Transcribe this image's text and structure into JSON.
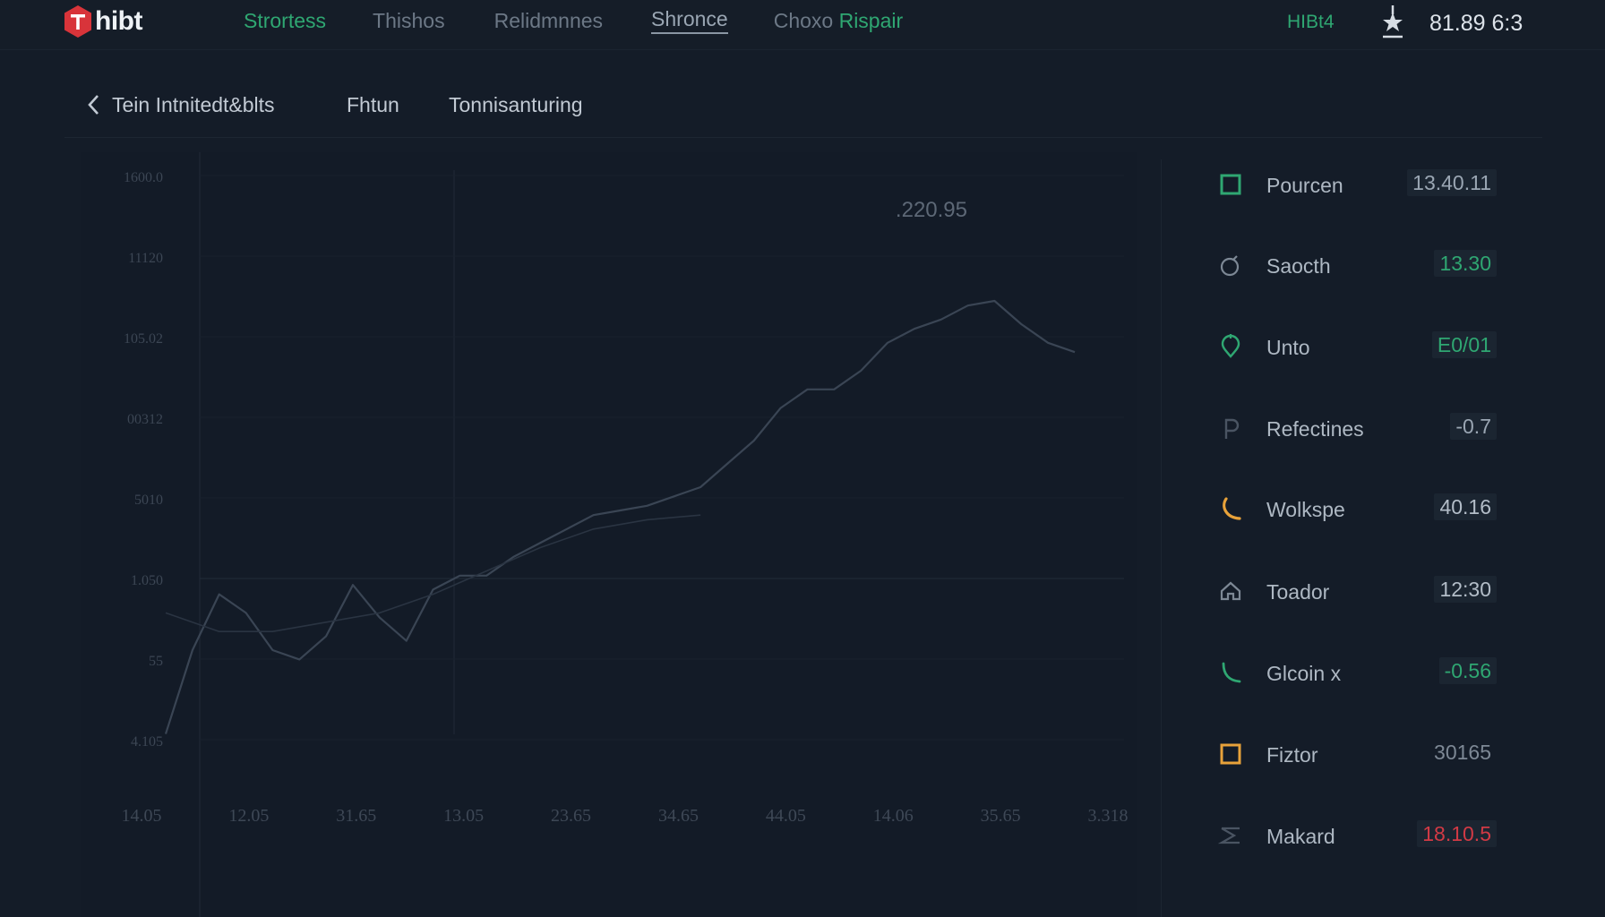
{
  "app": {
    "logo_text": "hibt"
  },
  "nav": {
    "items": [
      {
        "label": "Strortess"
      },
      {
        "label": "Thishos"
      },
      {
        "label": "Relidmnnes"
      },
      {
        "label": "Shronce"
      },
      {
        "label": "Choxo",
        "accent": "Rispair"
      }
    ]
  },
  "header": {
    "pair_label": "HIBt4",
    "clock": "81.89 6:3"
  },
  "subnav": {
    "back_label": "Tein Intnitedt&blts",
    "tabs": [
      "Fhtun",
      "Tonnisanturing"
    ]
  },
  "chart_data": {
    "type": "line",
    "title": "",
    "price_label": ".220.95",
    "y_ticks": [
      "1600.0",
      "11120",
      "105.02",
      "00312",
      "5010",
      "1.050",
      "55",
      "4.105"
    ],
    "x_ticks": [
      "14.05",
      "12.05",
      "31.65",
      "13.05",
      "23.65",
      "34.65",
      "44.05",
      "14.06",
      "35.65",
      "3.318"
    ],
    "ylim": [
      0,
      100
    ],
    "grid": true,
    "series": [
      {
        "color": "#3a4554",
        "x": [
          0,
          1,
          2,
          3,
          4,
          5,
          6,
          7,
          8,
          9,
          10,
          11,
          12,
          13,
          14,
          15,
          16,
          17,
          18,
          19,
          20,
          21,
          22,
          23,
          24,
          25,
          26,
          27,
          28,
          29,
          30,
          31,
          32,
          33,
          34
        ],
        "values": [
          2,
          20,
          32,
          28,
          20,
          18,
          23,
          34,
          27,
          22,
          33,
          36,
          36,
          40,
          43,
          46,
          49,
          50,
          51,
          53,
          55,
          60,
          65,
          72,
          76,
          76,
          80,
          86,
          89,
          91,
          94,
          95,
          90,
          86,
          84
        ]
      },
      {
        "color": "#2a3442",
        "x": [
          0,
          2,
          4,
          6,
          8,
          10,
          12,
          14,
          16,
          18,
          20
        ],
        "values": [
          28,
          24,
          24,
          26,
          28,
          32,
          37,
          42,
          46,
          48,
          49
        ]
      }
    ]
  },
  "side_items": [
    {
      "label": "Pourcen",
      "value": "13.40.11",
      "icon": "square-outline-icon",
      "icon_color": "#2fa772",
      "value_color": "#9aa6b3",
      "boxed": true
    },
    {
      "label": "Saocth",
      "value": "13.30",
      "icon": "bomb-icon",
      "icon_color": "#7d8895",
      "value_color": "#2fa772",
      "boxed": true
    },
    {
      "label": "Unto",
      "value": "E0/01",
      "icon": "pin-icon",
      "icon_color": "#2fa772",
      "value_color": "#2fa772",
      "boxed": true
    },
    {
      "label": "Refectines",
      "value": "-0.7",
      "icon": "p-icon",
      "icon_color": "#4a5462",
      "value_color": "#9aa6b3",
      "boxed": true
    },
    {
      "label": "Wolkspe",
      "value": "40.16",
      "icon": "moon-icon",
      "icon_color": "#e8a23a",
      "value_color": "#b3bdc8",
      "boxed": true
    },
    {
      "label": "Toador",
      "value": "12:30",
      "icon": "house-icon",
      "icon_color": "#7d8895",
      "value_color": "#b3bdc8",
      "boxed": true
    },
    {
      "label": "Glcoin x",
      "value": "-0.56",
      "icon": "curve-icon",
      "icon_color": "#2fa772",
      "value_color": "#2fa772",
      "boxed": true
    },
    {
      "label": "Fiztor",
      "value": "30165",
      "icon": "square-outline-icon",
      "icon_color": "#e8a23a",
      "value_color": "#7d8895",
      "boxed": false
    },
    {
      "label": "Makard",
      "value": "18.10.5",
      "icon": "stack-icon",
      "icon_color": "#4a5462",
      "value_color": "#d23a45",
      "boxed": true
    }
  ],
  "colors": {
    "accent": "#2fa772",
    "brand": "#d8343a",
    "background": "#141c28"
  }
}
